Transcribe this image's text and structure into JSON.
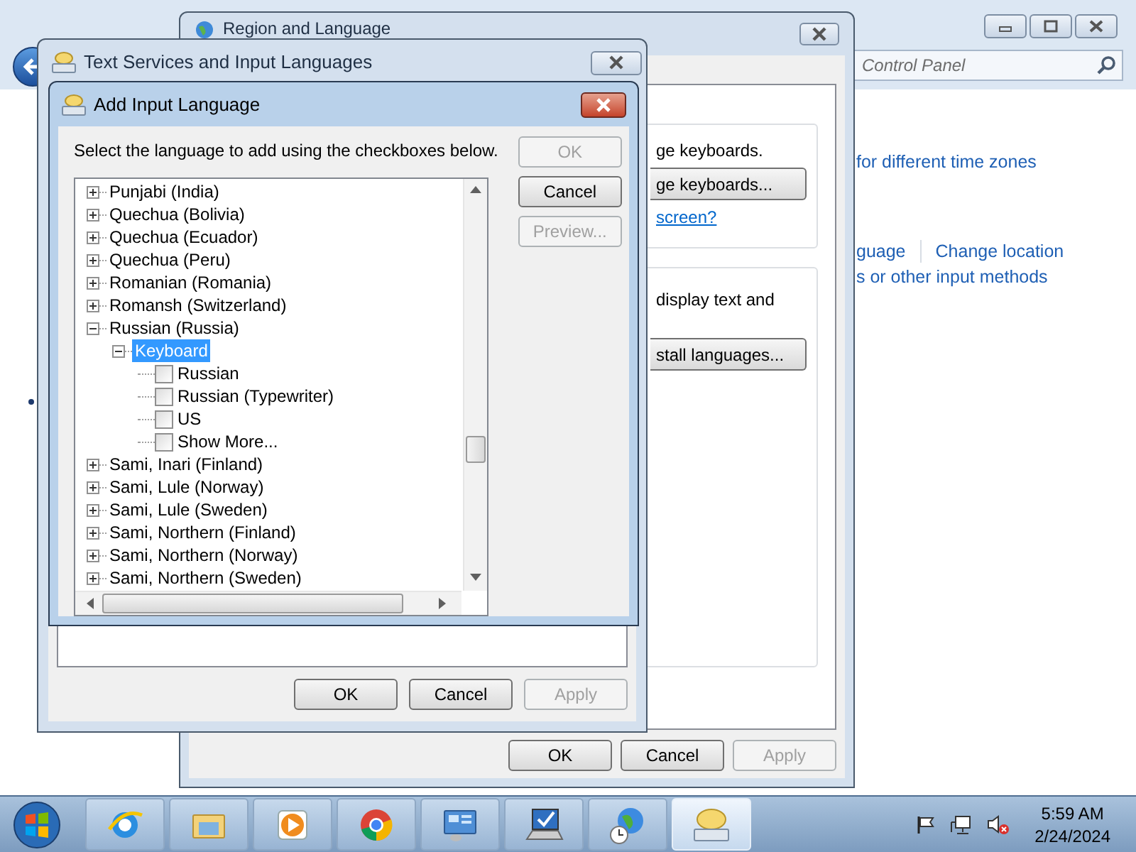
{
  "control_panel": {
    "search_placeholder": "Control Panel",
    "link_rows": [
      [
        "for different time zones"
      ],
      [
        "guage",
        "Change location"
      ],
      [
        "s or other input methods"
      ]
    ]
  },
  "region_window": {
    "title": "Region and Language",
    "keyboards_text": "ge keyboards.",
    "change_keyboards_button": "ge keyboards...",
    "help_link": "screen?",
    "display_text": "display text and",
    "install_button": "stall languages...",
    "buttons": [
      {
        "label": "OK",
        "disabled": false
      },
      {
        "label": "Cancel",
        "disabled": false
      },
      {
        "label": "Apply",
        "disabled": true
      }
    ]
  },
  "text_services_window": {
    "title": "Text Services and Input Languages",
    "buttons": [
      {
        "label": "OK",
        "disabled": false
      },
      {
        "label": "Cancel",
        "disabled": false
      },
      {
        "label": "Apply",
        "disabled": true
      }
    ]
  },
  "add_language_dialog": {
    "title": "Add Input Language",
    "instruction": "Select the language to add using the checkboxes below.",
    "buttons": [
      {
        "label": "OK",
        "disabled": true
      },
      {
        "label": "Cancel",
        "disabled": false
      },
      {
        "label": "Preview...",
        "disabled": true
      }
    ],
    "tree": [
      {
        "kind": "language",
        "label": "Punjabi (India)",
        "expanded": false,
        "selected": false
      },
      {
        "kind": "language",
        "label": "Quechua (Bolivia)",
        "expanded": false,
        "selected": false
      },
      {
        "kind": "language",
        "label": "Quechua (Ecuador)",
        "expanded": false,
        "selected": false
      },
      {
        "kind": "language",
        "label": "Quechua (Peru)",
        "expanded": false,
        "selected": false
      },
      {
        "kind": "language",
        "label": "Romanian (Romania)",
        "expanded": false,
        "selected": false
      },
      {
        "kind": "language",
        "label": "Romansh (Switzerland)",
        "expanded": false,
        "selected": false
      },
      {
        "kind": "language",
        "label": "Russian (Russia)",
        "expanded": true,
        "selected": false,
        "children": [
          {
            "kind": "group",
            "label": "Keyboard",
            "expanded": true,
            "selected": true,
            "children": [
              {
                "kind": "layout",
                "label": "Russian",
                "checked": false,
                "selected": false
              },
              {
                "kind": "layout",
                "label": "Russian (Typewriter)",
                "checked": false,
                "selected": false
              },
              {
                "kind": "layout",
                "label": "US",
                "checked": false,
                "selected": false
              },
              {
                "kind": "layout",
                "label": "Show More...",
                "checked": false,
                "selected": false
              }
            ]
          }
        ]
      },
      {
        "kind": "language",
        "label": "Sami, Inari (Finland)",
        "expanded": false,
        "selected": false
      },
      {
        "kind": "language",
        "label": "Sami, Lule (Norway)",
        "expanded": false,
        "selected": false
      },
      {
        "kind": "language",
        "label": "Sami, Lule (Sweden)",
        "expanded": false,
        "selected": false
      },
      {
        "kind": "language",
        "label": "Sami, Northern (Finland)",
        "expanded": false,
        "selected": false
      },
      {
        "kind": "language",
        "label": "Sami, Northern (Norway)",
        "expanded": false,
        "selected": false
      },
      {
        "kind": "language",
        "label": "Sami, Northern (Sweden)",
        "expanded": false,
        "selected": false
      }
    ]
  },
  "taskbar": {
    "apps": [
      {
        "kind": "browser",
        "selected": false
      },
      {
        "kind": "folder",
        "selected": false
      },
      {
        "kind": "media",
        "selected": false
      },
      {
        "kind": "chrome",
        "selected": false
      },
      {
        "kind": "control",
        "selected": false
      },
      {
        "kind": "computer",
        "selected": false
      },
      {
        "kind": "globe",
        "selected": false
      },
      {
        "kind": "keyboard",
        "selected": true
      }
    ],
    "clock": {
      "time": "5:59 AM",
      "date": "2/24/2024"
    }
  }
}
